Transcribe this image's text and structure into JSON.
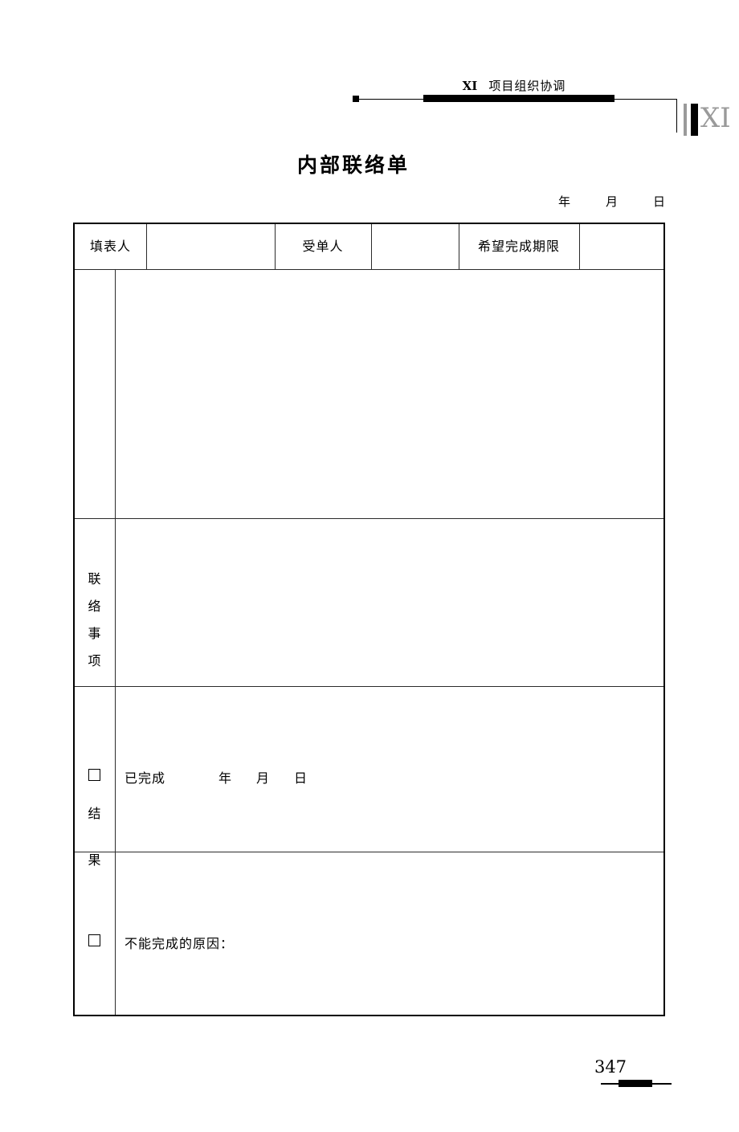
{
  "running_header": {
    "chapter_numeral": "XI",
    "chapter_title": "项目组织协调",
    "chapter_tab": "XI"
  },
  "form": {
    "title": "内部联络单",
    "date_line": {
      "year": "年",
      "month": "月",
      "day": "日"
    },
    "header_row": {
      "cells": [
        {
          "label": "填表人",
          "type": "label"
        },
        {
          "label": "",
          "type": "blank"
        },
        {
          "label": "受单人",
          "type": "label"
        },
        {
          "label": "",
          "type": "blank"
        },
        {
          "label": "希望完成期限",
          "type": "label"
        },
        {
          "label": "",
          "type": "blank"
        }
      ]
    },
    "sections": [
      {
        "label_chars": [
          "联",
          "络",
          "事",
          "项"
        ],
        "label": "联络事项",
        "content": ""
      },
      {
        "label_chars": [
          "结",
          "果"
        ],
        "label": "结果",
        "content": ""
      }
    ],
    "status_rows": [
      {
        "checkbox": "☐",
        "label": "已完成",
        "year": "年",
        "month": "月",
        "day": "日"
      },
      {
        "checkbox": "☐",
        "label": "不能完成的原因：",
        "year": "",
        "month": "",
        "day": ""
      }
    ]
  },
  "footer": {
    "page_number": "347"
  },
  "colors": {
    "ink": "#000000",
    "grid": "#2b2b2b",
    "tab_gray": "#9a9a9a",
    "paper": "#ffffff"
  }
}
